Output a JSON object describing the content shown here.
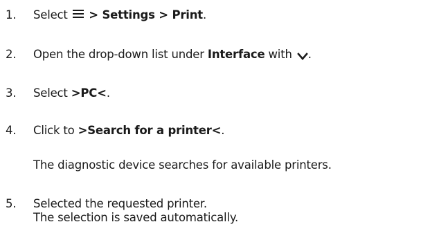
{
  "steps": [
    {
      "number": "1.",
      "prefix": "Select ",
      "menu_icon": "menu-icon",
      "path": " > Settings > Print",
      "suffix": "."
    },
    {
      "number": "2.",
      "prefix": "Open the drop-down list under ",
      "bold": "Interface",
      "middle": " with ",
      "chevron_icon": "chevron-down-icon",
      "suffix": "."
    },
    {
      "number": "3.",
      "prefix": "Select ",
      "bold": ">PC<",
      "suffix": "."
    },
    {
      "number": "4.",
      "prefix": "Click to ",
      "bold": ">Search for a printer<",
      "suffix": ".",
      "result": "The diagnostic device searches for available printers."
    },
    {
      "number": "5.",
      "line1": "Selected the requested printer.",
      "line2": "The selection is saved automatically."
    }
  ]
}
